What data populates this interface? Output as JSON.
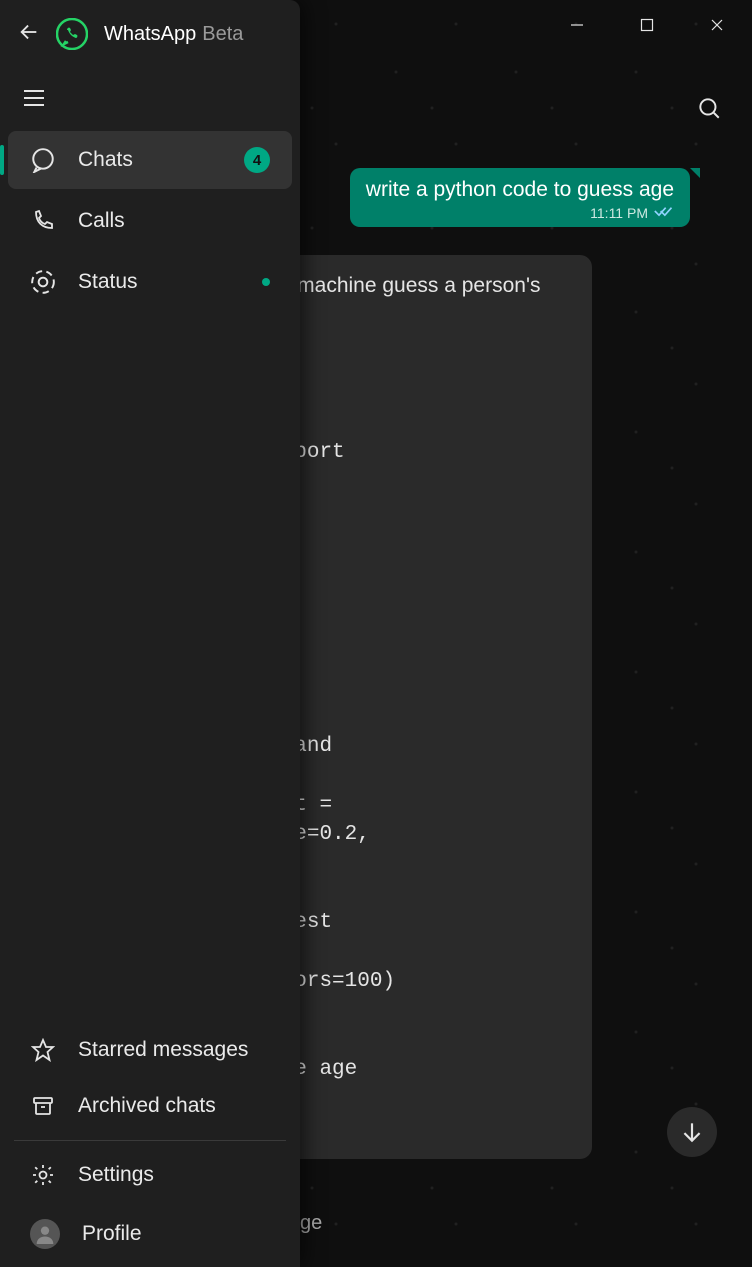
{
  "app": {
    "name": "WhatsApp",
    "edition": "Beta"
  },
  "sidebar": {
    "items": {
      "chats": {
        "label": "Chats",
        "badge": "4"
      },
      "calls": {
        "label": "Calls"
      },
      "status": {
        "label": "Status"
      }
    },
    "bottom": {
      "starred": "Starred messages",
      "archived": "Archived chats",
      "settings": "Settings",
      "profile": "Profile"
    }
  },
  "chat": {
    "outgoing": {
      "text": "write a python code to guess age",
      "time": "11:11 PM"
    },
    "incoming": {
      "intro": "ython code that uses a machine guess a person's age based on",
      "code": " as pd\nnsemble import\ngressor\nodel_selection import\nit\n\naset\n_csv(\"ages.csv\")\n\nhe data\n\"]\n]\n\nta into training and\n\nt, y_train, y_test =\nit(X, y, test_size=0.2,\n2)\n\nrain a random forest\n\ngressor(n_estimators=100)\nain, y_train)\n\nction to guess the age\ne\nname):"
    },
    "input_placeholder": "ge"
  }
}
